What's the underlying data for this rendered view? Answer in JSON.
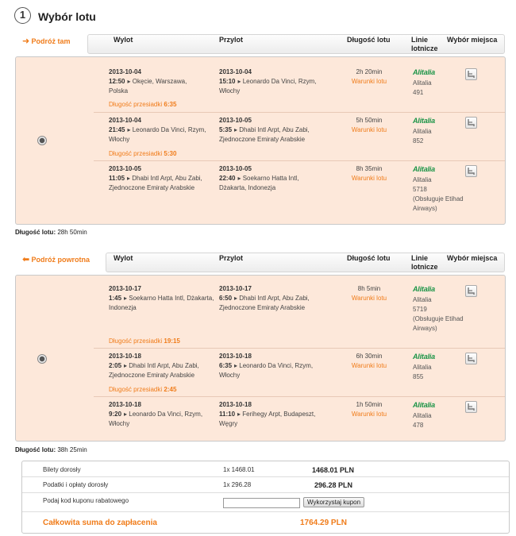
{
  "step": {
    "number": "1",
    "title": "Wybór lotu"
  },
  "columns": {
    "departure": "Wylot",
    "arrival": "Przylot",
    "duration": "Długość lotu",
    "airlines_1": "Linie",
    "airlines_2": "lotnicze",
    "seat": "Wybór miejsca"
  },
  "conditions_label": "Warunki lotu",
  "outbound": {
    "label": "Podróż tam",
    "segments": [
      {
        "dep_date": "2013-10-04",
        "dep_time": "12:50",
        "dep_place_1": "Okęcie, Warszawa,",
        "dep_place_2": "Polska",
        "arr_date": "2013-10-04",
        "arr_time": "15:10",
        "arr_place_1": "Leonardo Da Vinci, Rzym,",
        "arr_place_2": "Włochy",
        "duration": "2h 20min",
        "airline": "Alitalia",
        "flight": "491",
        "operated_1": "",
        "operated_2": ""
      },
      {
        "dep_date": "2013-10-04",
        "dep_time": "21:45",
        "dep_place_1": "Leonardo Da Vinci, Rzym,",
        "dep_place_2": "Włochy",
        "arr_date": "2013-10-05",
        "arr_time": "5:35",
        "arr_place_1": "Dhabi Intl Arpt, Abu Zabi,",
        "arr_place_2": "Zjednoczone Emiraty Arabskie",
        "duration": "5h 50min",
        "airline": "Alitalia",
        "flight": "852",
        "operated_1": "",
        "operated_2": ""
      },
      {
        "dep_date": "2013-10-05",
        "dep_time": "11:05",
        "dep_place_1": "Dhabi Intl Arpt, Abu Zabi,",
        "dep_place_2": "Zjednoczone Emiraty Arabskie",
        "arr_date": "2013-10-05",
        "arr_time": "22:40",
        "arr_place_1": "Soekarno Hatta Intl,",
        "arr_place_2": "Dżakarta, Indonezja",
        "duration": "8h 35min",
        "airline": "Alitalia",
        "flight": "5718",
        "operated_1": "(Obsługuje Etihad",
        "operated_2": "Airways)"
      }
    ],
    "connections": [
      {
        "label": "Długość przesiadki",
        "value": "6:35"
      },
      {
        "label": "Długość przesiadki",
        "value": "5:30"
      }
    ],
    "total_label": "Długość lotu:",
    "total_value": "28h 50min"
  },
  "return": {
    "label": "Podróż powrotna",
    "segments": [
      {
        "dep_date": "2013-10-17",
        "dep_time": "1:45",
        "dep_place_1": "Soekarno Hatta Intl, Dżakarta,",
        "dep_place_2": "Indonezja",
        "arr_date": "2013-10-17",
        "arr_time": "6:50",
        "arr_place_1": "Dhabi Intl Arpt, Abu Zabi,",
        "arr_place_2": "Zjednoczone Emiraty Arabskie",
        "duration": "8h 5min",
        "airline": "Alitalia",
        "flight": "5719",
        "operated_1": "(Obsługuje Etihad",
        "operated_2": "Airways)"
      },
      {
        "dep_date": "2013-10-18",
        "dep_time": "2:05",
        "dep_place_1": "Dhabi Intl Arpt, Abu Zabi,",
        "dep_place_2": "Zjednoczone Emiraty Arabskie",
        "arr_date": "2013-10-18",
        "arr_time": "6:35",
        "arr_place_1": "Leonardo Da Vinci, Rzym,",
        "arr_place_2": "Włochy",
        "duration": "6h 30min",
        "airline": "Alitalia",
        "flight": "855",
        "operated_1": "",
        "operated_2": ""
      },
      {
        "dep_date": "2013-10-18",
        "dep_time": "9:20",
        "dep_place_1": "Leonardo Da Vinci, Rzym,",
        "dep_place_2": "Włochy",
        "arr_date": "2013-10-18",
        "arr_time": "11:10",
        "arr_place_1": "Ferihegy Arpt, Budapeszt,",
        "arr_place_2": "Węgry",
        "duration": "1h 50min",
        "airline": "Alitalia",
        "flight": "478",
        "operated_1": "",
        "operated_2": ""
      }
    ],
    "connections": [
      {
        "label": "Długość przesiadki",
        "value": "19:15"
      },
      {
        "label": "Długość przesiadki",
        "value": "2:45"
      }
    ],
    "total_label": "Długość lotu:",
    "total_value": "38h 25min"
  },
  "logo_text": "Alitalia",
  "summary": {
    "adult_tickets": {
      "label": "Bilety dorosły",
      "qty": "1x 1468.01",
      "price": "1468.01 PLN"
    },
    "adult_taxes": {
      "label": "Podatki i opłaty dorosły",
      "qty": "1x 296.28",
      "price": "296.28 PLN"
    },
    "coupon": {
      "label": "Podaj kod kuponu rabatowego",
      "placeholder": "",
      "button": "Wykorzystaj kupon"
    },
    "total": {
      "label": "Całkowita suma do zapłacenia",
      "price": "1764.29 PLN"
    }
  },
  "colors": {
    "accent": "#f07c1a",
    "panel": "#fde8da",
    "logo": "#1b9447"
  }
}
